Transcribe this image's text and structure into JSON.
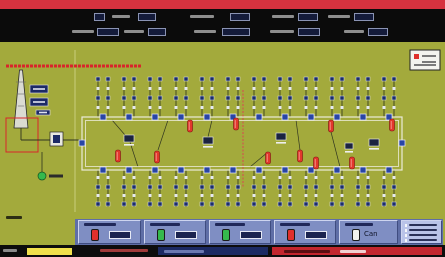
{
  "colors": {
    "alarm_bar": "#d7323f",
    "header_bg": "#0b0b0b",
    "canvas_olive": "#a3aa3c",
    "bus_line": "#ecebd8",
    "breaker_blue": "#2845a6",
    "unit_red": "#e2372c",
    "panel_blue": "#7f8ec3",
    "status_yellow": "#f0e04c",
    "status_red": "#c3262e",
    "lamp_green": "#35b94d",
    "lamp_red": "#e0302c",
    "lamp_white": "#f2f2ee",
    "dashed_red": "#d94850"
  },
  "icons": {
    "tower": "tower-icon",
    "breaker": "breaker-icon",
    "unit": "red-unit-icon",
    "lamp": "indicator-lamp-icon",
    "legend": "legend-box-icon",
    "status_dot": "green-status-dot-icon"
  },
  "status_panels": [
    {
      "lamp": "red"
    },
    {
      "lamp": "green"
    },
    {
      "lamp": "green"
    },
    {
      "lamp": "red"
    },
    {
      "lamp": "white",
      "label": "Can"
    }
  ]
}
